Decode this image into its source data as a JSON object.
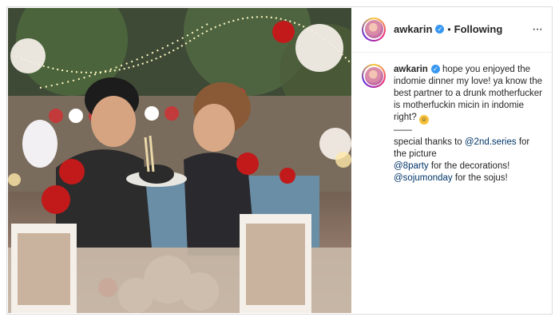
{
  "post": {
    "username": "awkarin",
    "separator": "•",
    "follow_status": "Following",
    "more_label": "···"
  },
  "caption": {
    "username": "awkarin",
    "line_main": "hope you enjoyed the indomie dinner my love! ya know the best partner to a drunk motherfucker is motherfuckin micin in indomie right?",
    "divider": "——",
    "thanks_prefix": "special thanks to",
    "thanks_mention": "@2nd.series",
    "thanks_suffix": "for the picture",
    "party_mention": "@8party",
    "party_suffix": "for the decorations!",
    "soju_mention": "@sojumonday",
    "soju_suffix": "for the sojus!"
  },
  "colors": {
    "mention": "#003569",
    "verified": "#3897f0",
    "border": "#dbdbdb"
  },
  "icons": {
    "verified": "verified-badge-icon",
    "more": "more-options-icon",
    "emoji": "grinning-emoji-icon"
  }
}
